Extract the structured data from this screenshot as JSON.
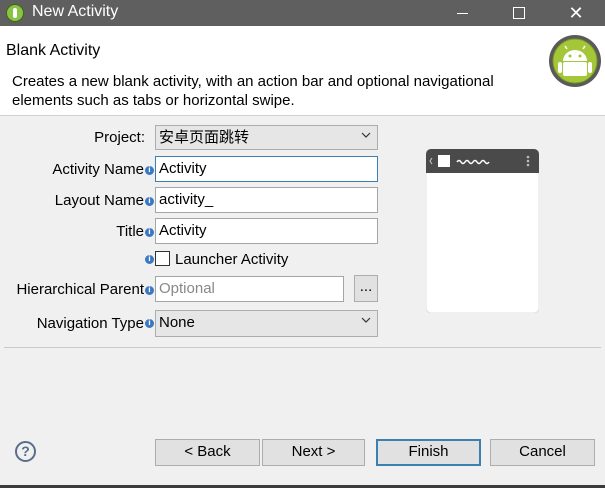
{
  "window": {
    "title": "New Activity"
  },
  "header": {
    "title": "Blank Activity",
    "description": "Creates a new blank activity, with an action bar and optional navigational elements such as tabs or horizontal swipe."
  },
  "form": {
    "project": {
      "label": "Project:",
      "value": "安卓页面跳转"
    },
    "activity_name": {
      "label": "Activity Name",
      "value": "Activity"
    },
    "layout_name": {
      "label": "Layout Name",
      "value": "activity_"
    },
    "title": {
      "label": "Title",
      "value": "Activity"
    },
    "launcher": {
      "label": "Launcher Activity",
      "checked": false
    },
    "hierarchical_parent": {
      "label": "Hierarchical Parent",
      "placeholder": "Optional",
      "browse_label": "..."
    },
    "navigation_type": {
      "label": "Navigation Type",
      "value": "None"
    }
  },
  "footer": {
    "help_label": "?",
    "back_label": "< Back",
    "next_label": "Next >",
    "finish_label": "Finish",
    "cancel_label": "Cancel"
  },
  "colors": {
    "accent": "#3c7fb1",
    "titlebar": "#5f5f5f",
    "android_green": "#a4c639"
  }
}
